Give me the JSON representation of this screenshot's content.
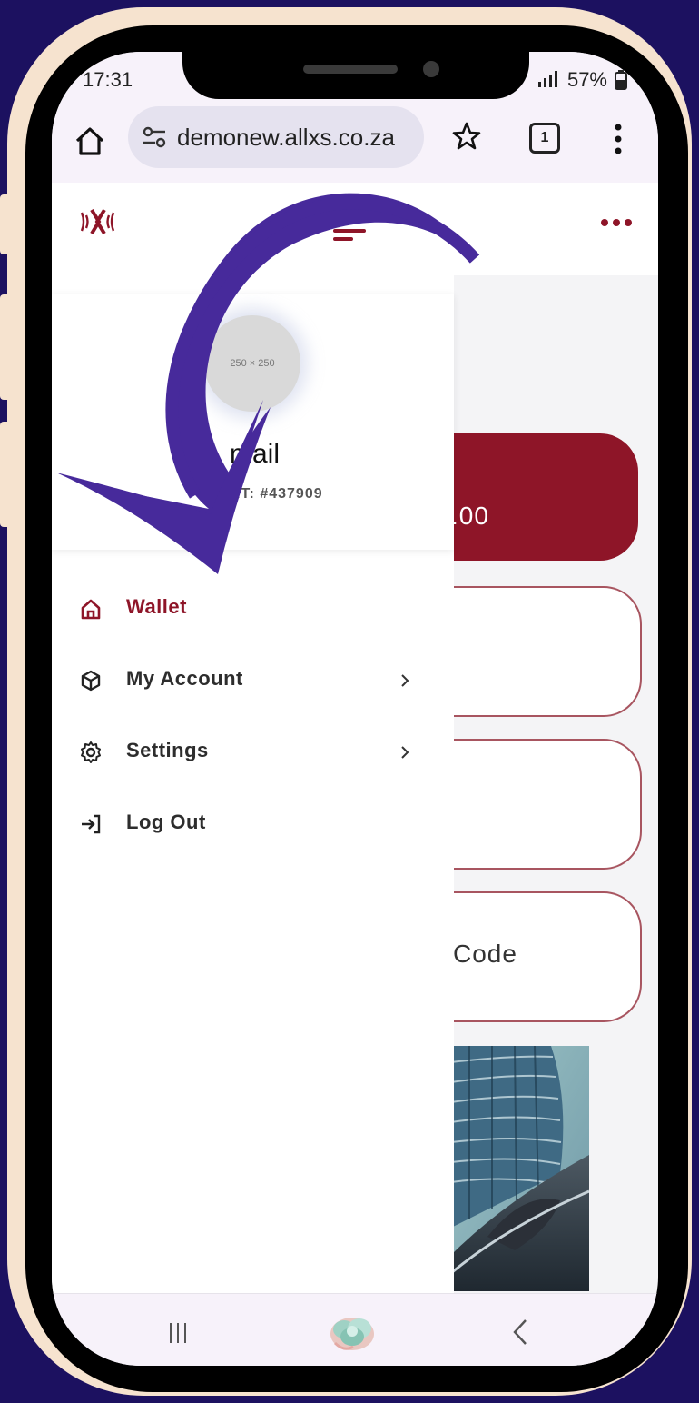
{
  "status_bar": {
    "time": "17:31",
    "battery": "57%"
  },
  "browser": {
    "url": "demonew.allxs.co.za",
    "tab_count": "1"
  },
  "app": {
    "brand_color": "#8e1528"
  },
  "profile": {
    "avatar_placeholder": "250 × 250",
    "name_fragment": "mail",
    "account_fragment": "NT: #437909"
  },
  "menu": {
    "items": [
      {
        "label": "Wallet",
        "icon": "home-icon",
        "active": true,
        "has_chevron": false
      },
      {
        "label": "My Account",
        "icon": "box-icon",
        "active": false,
        "has_chevron": true
      },
      {
        "label": "Settings",
        "icon": "gear-icon",
        "active": false,
        "has_chevron": true
      },
      {
        "label": "Log Out",
        "icon": "logout-icon",
        "active": false,
        "has_chevron": false
      }
    ]
  },
  "background": {
    "balance_fragment": ".00",
    "code_fragment": "Code"
  },
  "overlay": {
    "arrow_color": "#472a9b"
  }
}
